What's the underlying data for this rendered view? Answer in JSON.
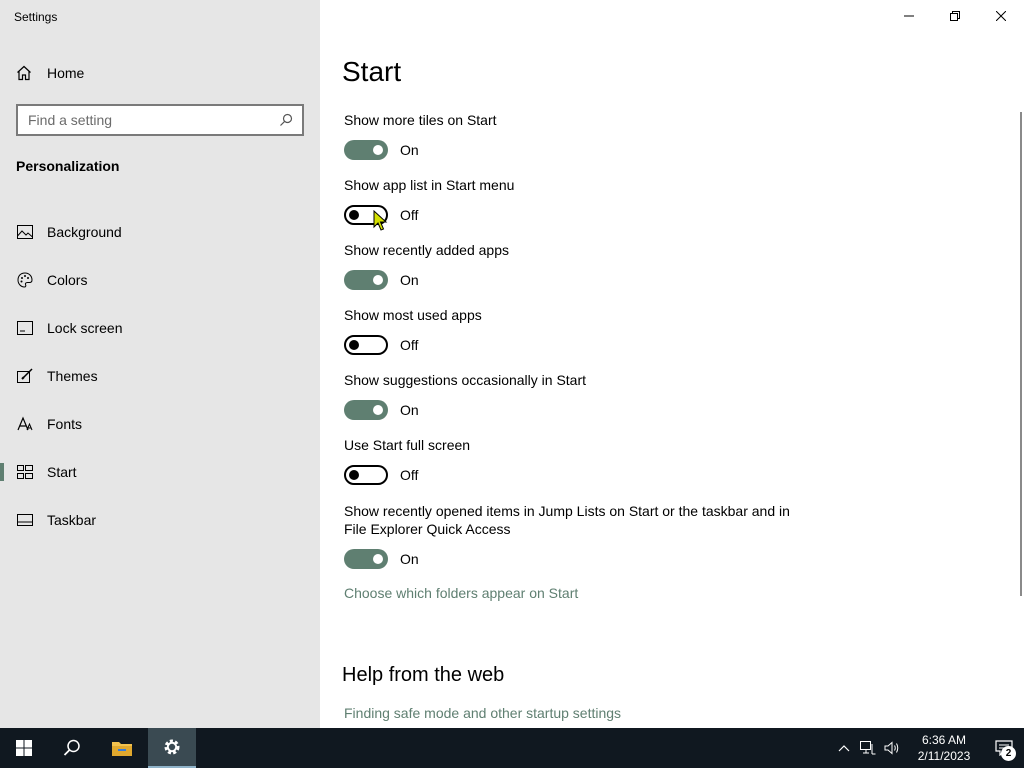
{
  "window": {
    "title": "Settings"
  },
  "sidebar": {
    "home_label": "Home",
    "search_placeholder": "Find a setting",
    "section_title": "Personalization",
    "items": [
      {
        "label": "Background",
        "icon": "image-icon"
      },
      {
        "label": "Colors",
        "icon": "palette-icon"
      },
      {
        "label": "Lock screen",
        "icon": "lock-screen-icon"
      },
      {
        "label": "Themes",
        "icon": "themes-icon"
      },
      {
        "label": "Fonts",
        "icon": "font-icon"
      },
      {
        "label": "Start",
        "icon": "start-icon",
        "active": true
      },
      {
        "label": "Taskbar",
        "icon": "taskbar-icon"
      }
    ]
  },
  "main": {
    "title": "Start",
    "settings": [
      {
        "label": "Show more tiles on Start",
        "state": "On",
        "on": true
      },
      {
        "label": "Show app list in Start menu",
        "state": "Off",
        "on": false
      },
      {
        "label": "Show recently added apps",
        "state": "On",
        "on": true
      },
      {
        "label": "Show most used apps",
        "state": "Off",
        "on": false
      },
      {
        "label": "Show suggestions occasionally in Start",
        "state": "On",
        "on": true
      },
      {
        "label": "Use Start full screen",
        "state": "Off",
        "on": false
      },
      {
        "label": "Show recently opened items in Jump Lists on Start or the taskbar and in File Explorer Quick Access",
        "state": "On",
        "on": true
      }
    ],
    "folders_link": "Choose which folders appear on Start",
    "help_title": "Help from the web",
    "help_link": "Finding safe mode and other startup settings"
  },
  "taskbar": {
    "time": "6:36 AM",
    "date": "2/11/2023",
    "notification_count": "2"
  },
  "colors": {
    "accent": "#5f7f71",
    "taskbar": "#101820",
    "sidebar": "#e6e6e6"
  }
}
